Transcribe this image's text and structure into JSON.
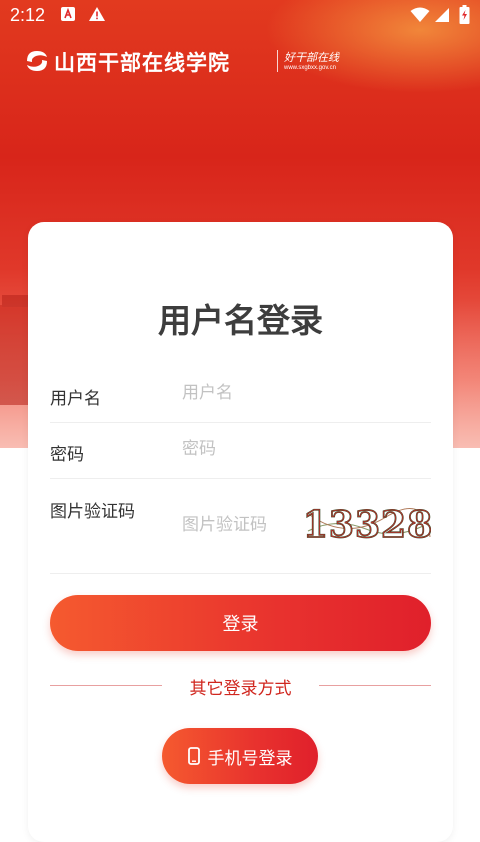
{
  "status_bar": {
    "time": "2:12",
    "icons": [
      "a-badge-icon",
      "warning-icon",
      "wifi-icon",
      "signal-icon",
      "battery-icon"
    ]
  },
  "header": {
    "site_name": "山西干部在线学院",
    "slogan": "好干部在线",
    "url": "www.sxgbxx.gov.cn"
  },
  "login": {
    "title": "用户名登录",
    "username_label": "用户名",
    "username_placeholder": "用户名",
    "password_label": "密码",
    "password_placeholder": "密码",
    "captcha_label": "图片验证码",
    "captcha_placeholder": "图片验证码",
    "captcha_text": "13328",
    "submit_label": "登录",
    "other_methods_label": "其它登录方式",
    "phone_login_label": "手机号登录"
  },
  "colors": {
    "brand_red": "#e0282a",
    "accent_orange": "#f55a2f",
    "text_dark": "#333333",
    "placeholder": "#c2c2c2"
  }
}
